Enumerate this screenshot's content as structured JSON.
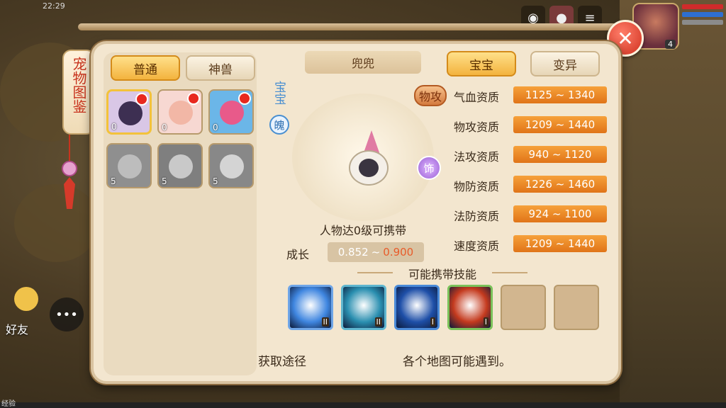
{
  "status": {
    "time": "22:29"
  },
  "player": {
    "level": "4"
  },
  "hud": {
    "friend_label": "好友",
    "exp_label": "经验"
  },
  "side_title": "宠物图鉴",
  "tabs_left": [
    {
      "label": "普通",
      "active": true
    },
    {
      "label": "神兽",
      "active": false
    }
  ],
  "tabs_right": [
    {
      "label": "宝宝",
      "active": true
    },
    {
      "label": "变异",
      "active": false
    }
  ],
  "pets": [
    {
      "count": "0",
      "face_color": "#3d2f52",
      "bg": "#d9c7e6",
      "red_dot": true,
      "gray": false
    },
    {
      "count": "0",
      "face_color": "#f2b7a6",
      "bg": "#f7d8d2",
      "red_dot": true,
      "gray": false
    },
    {
      "count": "0",
      "face_color": "#e85a8a",
      "bg": "#6bb6e8",
      "red_dot": true,
      "gray": false
    },
    {
      "count": "5",
      "face_color": "#bdbdbd",
      "bg": "#8f8f8f",
      "red_dot": false,
      "gray": true
    },
    {
      "count": "5",
      "face_color": "#c9c9c9",
      "bg": "#7f7f7f",
      "red_dot": false,
      "gray": true
    },
    {
      "count": "5",
      "face_color": "#d4d4d4",
      "bg": "#888888",
      "red_dot": false,
      "gray": true
    }
  ],
  "pet_name": "兜兜",
  "pet_type_vertical": "宝宝",
  "pet_badge": "魄",
  "attack_type": "物攻",
  "ornament_badge": "饰",
  "carry_text": "人物达0级可携带",
  "growth": {
    "label": "成长",
    "low": "0.852",
    "sep": "~",
    "high": "0.900"
  },
  "stats": [
    {
      "label": "气血资质",
      "value": "1125 ~ 1340"
    },
    {
      "label": "物攻资质",
      "value": "1209 ~ 1440"
    },
    {
      "label": "法攻资质",
      "value": "940 ~ 1120"
    },
    {
      "label": "物防资质",
      "value": "1226 ~ 1460"
    },
    {
      "label": "法防资质",
      "value": "924 ~ 1100"
    },
    {
      "label": "速度资质",
      "value": "1209 ~ 1440"
    }
  ],
  "skills_title": "可能携带技能",
  "skills": [
    {
      "level": "II",
      "color": "#3f86e0",
      "border": "#6fa6e8",
      "empty": false
    },
    {
      "level": "II",
      "color": "#2a8fb0",
      "border": "#5fb6cf",
      "empty": false
    },
    {
      "level": "I",
      "color": "#1e4fa8",
      "border": "#4a8ad8",
      "empty": false
    },
    {
      "level": "I",
      "color": "#c43a1e",
      "border": "#7ac25a",
      "empty": false
    },
    {
      "level": "",
      "color": "",
      "border": "",
      "empty": true
    },
    {
      "level": "",
      "color": "",
      "border": "",
      "empty": true
    }
  ],
  "obtain": {
    "label": "获取途径",
    "value": "各个地图可能遇到。"
  },
  "close_glyph": "✕"
}
